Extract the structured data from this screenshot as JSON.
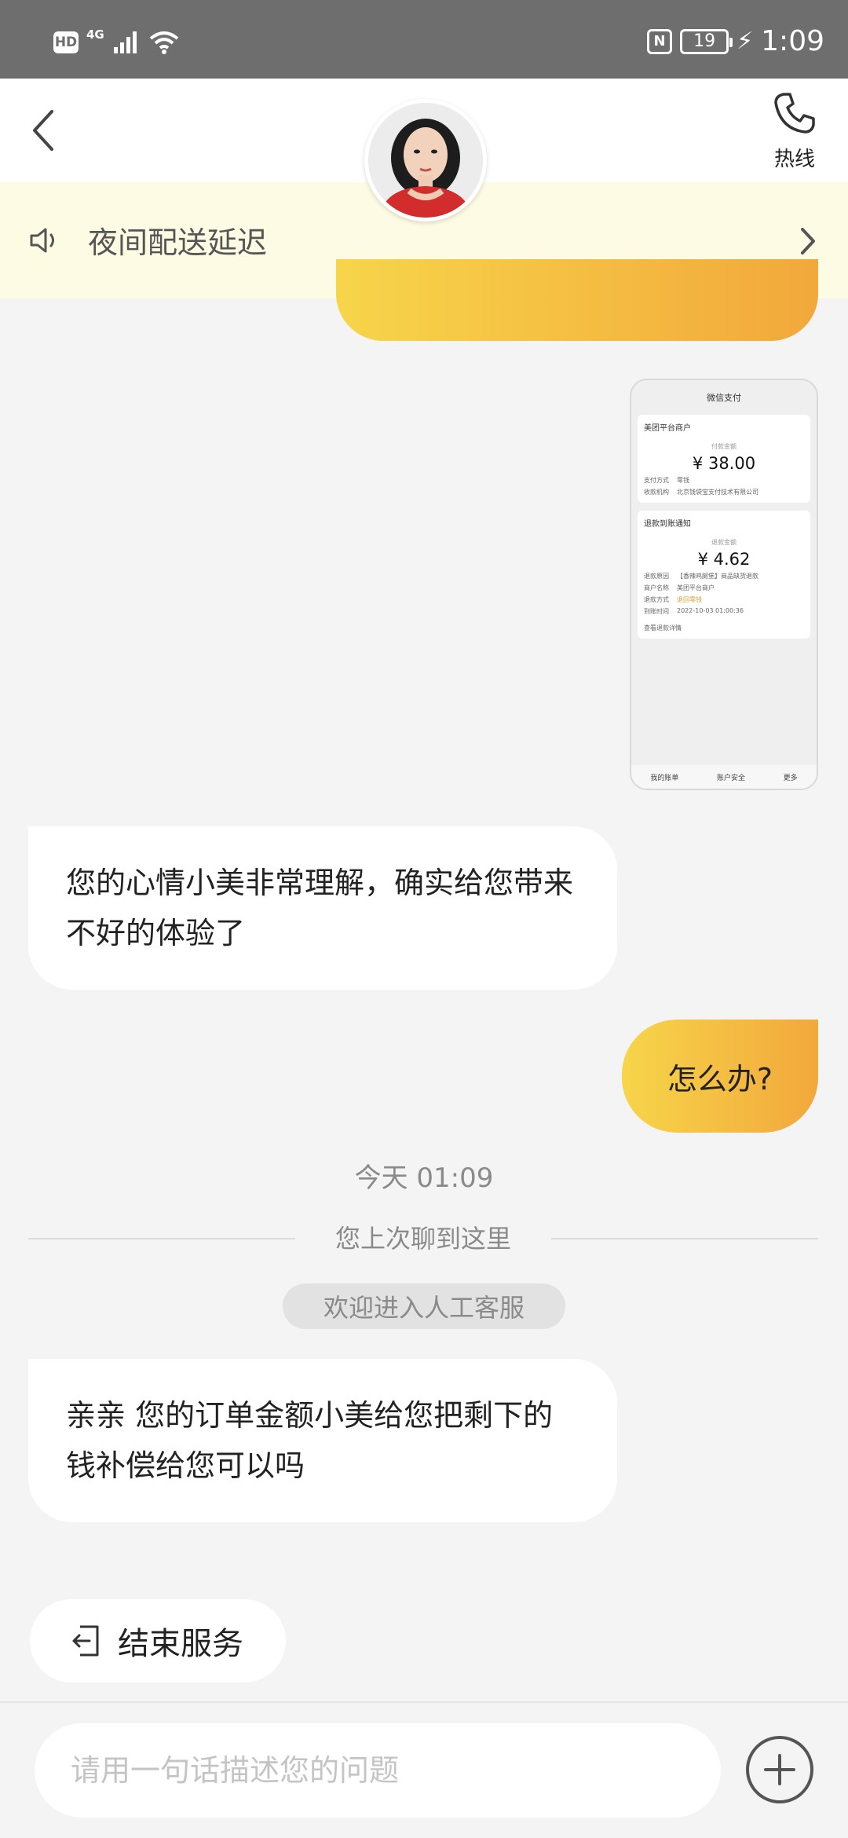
{
  "status_bar": {
    "hd": "HD",
    "network": "4G",
    "nfc": "N",
    "battery": "19",
    "time": "1:09"
  },
  "header": {
    "hotline_label": "热线"
  },
  "notice": {
    "text": "夜间配送延迟"
  },
  "shared_screenshot": {
    "title": "微信支付",
    "merchant": "美团平台商户",
    "paid_label": "付款金额",
    "paid_amount": "¥ 38.00",
    "pay_method_label": "支付方式",
    "pay_method": "零钱",
    "payee_label": "收款机构",
    "payee": "北京钱袋宝支付技术有限公司",
    "section_title": "退款到账通知",
    "refund_label": "退款金额",
    "refund_amount": "¥ 4.62",
    "refund_reason_label": "退款原因",
    "refund_reason": "【香辣鸡腿堡】商品缺货退款",
    "merchant_name_label": "商户名称",
    "merchant_name": "美团平台商户",
    "refund_method_label": "退款方式",
    "refund_method": "退回零钱",
    "arrival_time_label": "到账时间",
    "arrival_time": "2022-10-03 01:00:36",
    "more_label": "查看退款详情",
    "footer_1": "我的账单",
    "footer_2": "账户安全",
    "footer_3": "更多"
  },
  "messages": {
    "agent_1": "您的心情小美非常理解，确实给您带来不好的体验了",
    "user_1": "怎么办?",
    "timestamp": "今天 01:09",
    "divider": "您上次聊到这里",
    "welcome": "欢迎进入人工客服",
    "agent_2": "亲亲 您的订单金额小美给您把剩下的钱补偿给您可以吗"
  },
  "actions": {
    "end_service": "结束服务"
  },
  "input": {
    "placeholder": "请用一句话描述您的问题"
  },
  "colors": {
    "accent_start": "#f7d54a",
    "accent_end": "#f2a83b",
    "notice_bg": "#fefbe4"
  }
}
